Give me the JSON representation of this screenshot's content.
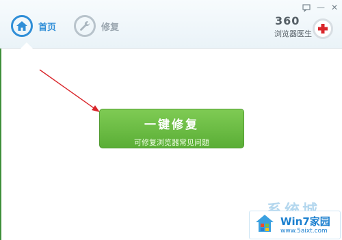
{
  "nav": {
    "tabs": [
      {
        "label": "首页",
        "icon": "home-icon",
        "active": true
      },
      {
        "label": "修复",
        "icon": "wrench-icon",
        "active": false
      }
    ]
  },
  "window_controls": {
    "feedback_icon": "message-icon",
    "minimize": "—",
    "close": "✕"
  },
  "brand": {
    "number": "360",
    "name": "浏览器医生",
    "icon": "red-cross-icon"
  },
  "main_button": {
    "title": "一键修复",
    "subtitle": "可修复浏览器常见问题"
  },
  "watermark": {
    "big": "系统城",
    "title": "Win7家园",
    "url": "www.5aixt.com"
  },
  "colors": {
    "accent": "#2f8ed7",
    "button_green": "#5aae36",
    "arrow_red": "#d9262b"
  }
}
